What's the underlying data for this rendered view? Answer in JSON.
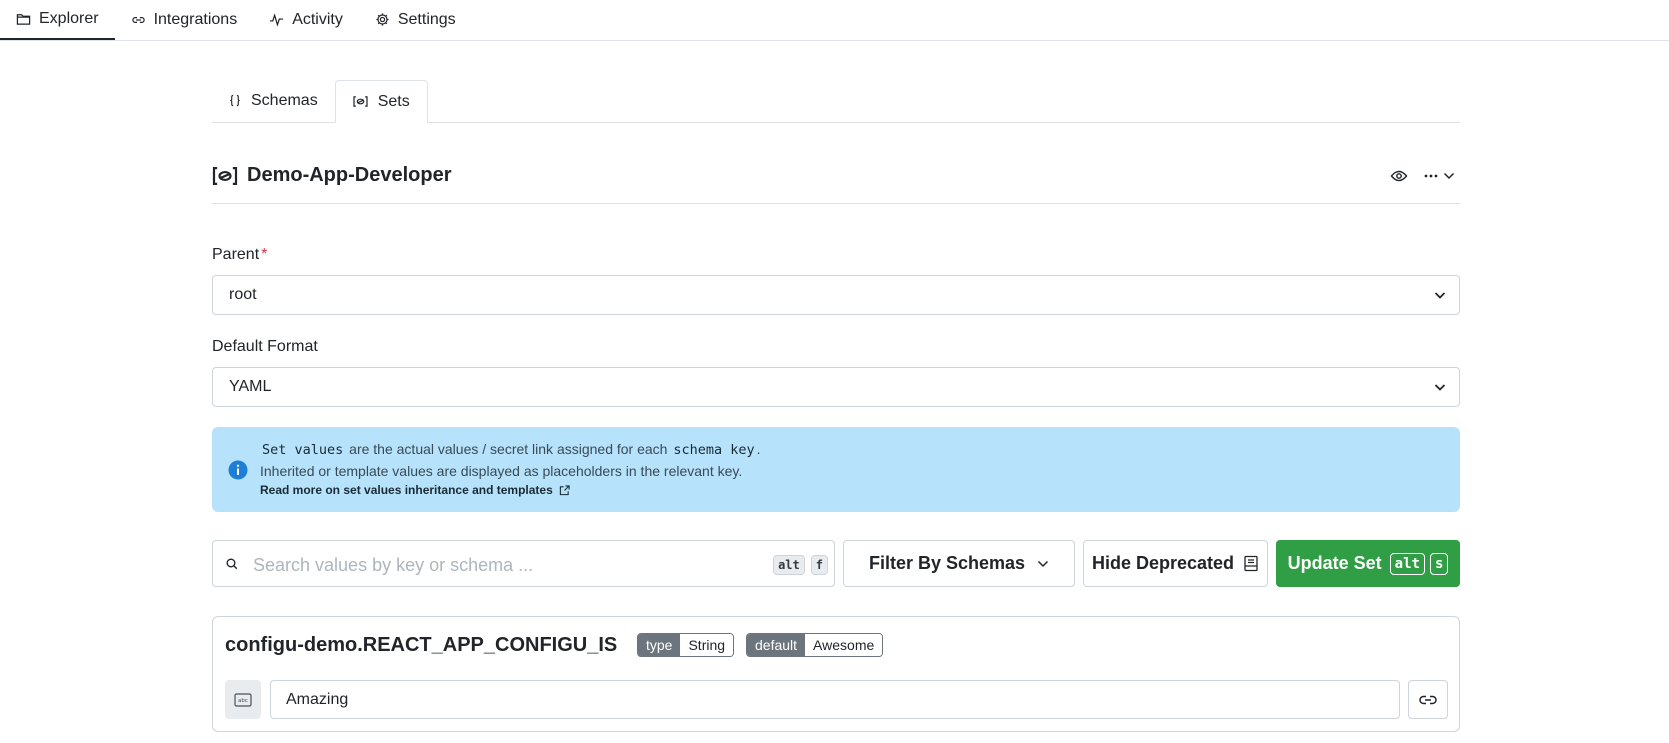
{
  "topnav": {
    "items": [
      {
        "label": "Explorer",
        "icon": "folder-icon",
        "active": true
      },
      {
        "label": "Integrations",
        "icon": "link-icon",
        "active": false
      },
      {
        "label": "Activity",
        "icon": "activity-icon",
        "active": false
      },
      {
        "label": "Settings",
        "icon": "gear-icon",
        "active": false
      }
    ]
  },
  "tabs": [
    {
      "label": "Schemas",
      "icon": "braces-icon",
      "active": false
    },
    {
      "label": "Sets",
      "icon": "set-icon",
      "active": true
    }
  ],
  "set": {
    "title": "Demo-App-Developer",
    "actions": [
      "eye-icon",
      "more-icon",
      "chevron-down-icon"
    ]
  },
  "form": {
    "parent_label": "Parent",
    "parent_required": "*",
    "parent_value": "root",
    "format_label": "Default Format",
    "format_value": "YAML"
  },
  "alert": {
    "code1": "Set values",
    "text1": "are the actual values / secret link assigned for each",
    "code2": "schema key",
    "text1_end": ".",
    "line2": "Inherited or template values are displayed as placeholders in the relevant key.",
    "link": "Read more on set values inheritance and templates",
    "color": "#b6e2fb"
  },
  "toolbar": {
    "search_placeholder": "Search values by key or schema ...",
    "search_kbd1": "alt",
    "search_kbd2": "f",
    "filter_label": "Filter By Schemas",
    "hide_label": "Hide Deprecated",
    "update_label": "Update Set",
    "update_kbd1": "alt",
    "update_kbd2": "s",
    "update_color": "#2f9e44"
  },
  "card": {
    "key": "configu-demo.REACT_APP_CONFIGU_IS",
    "type_label": "type",
    "type_value": "String",
    "default_label": "default",
    "default_value": "Awesome",
    "value": "Amazing"
  }
}
